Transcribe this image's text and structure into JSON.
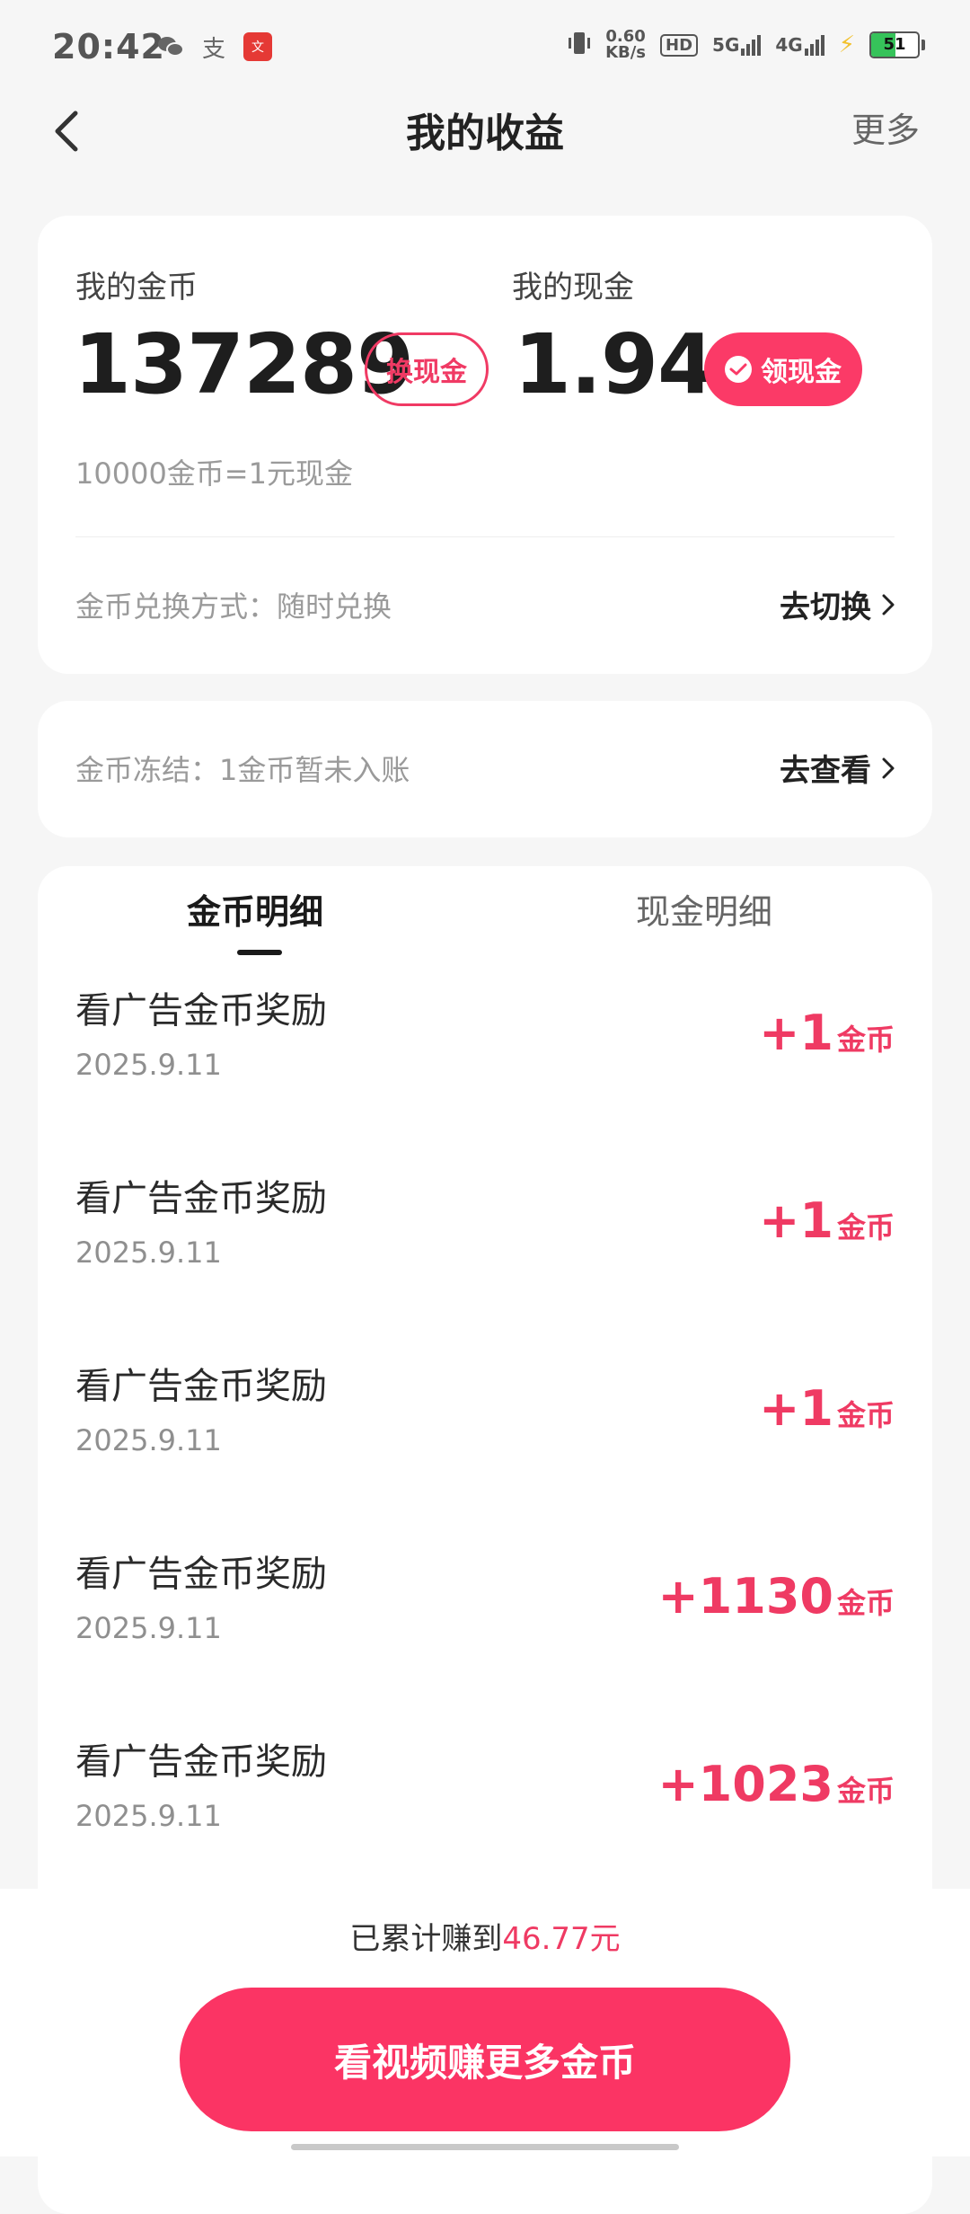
{
  "status_bar": {
    "time": "20:42",
    "speed_value": "0.60",
    "speed_unit": "KB/s",
    "hd": "HD",
    "sig1": "5G",
    "sig2": "4G",
    "battery": "51",
    "battery_level": 51,
    "app_badge": "文",
    "pay_glyph": "支"
  },
  "header": {
    "title": "我的收益",
    "more": "更多"
  },
  "balance": {
    "coins_label": "我的金币",
    "coins_value": "137289",
    "exchange_btn": "换现金",
    "cash_label": "我的现金",
    "cash_value": "1.94",
    "claim_btn": "领现金",
    "rate": "10000金币=1元现金",
    "method_text": "金币兑换方式：随时兑换",
    "method_link": "去切换"
  },
  "freeze": {
    "text": "金币冻结：1金币暂未入账",
    "link": "去查看"
  },
  "tabs": {
    "coins": "金币明细",
    "cash": "现金明细"
  },
  "records": [
    {
      "title": "看广告金币奖励",
      "date": "2025.9.11",
      "amount": "+1",
      "unit": "金币"
    },
    {
      "title": "看广告金币奖励",
      "date": "2025.9.11",
      "amount": "+1",
      "unit": "金币"
    },
    {
      "title": "看广告金币奖励",
      "date": "2025.9.11",
      "amount": "+1",
      "unit": "金币"
    },
    {
      "title": "看广告金币奖励",
      "date": "2025.9.11",
      "amount": "+1130",
      "unit": "金币"
    },
    {
      "title": "看广告金币奖励",
      "date": "2025.9.11",
      "amount": "+1023",
      "unit": "金币"
    }
  ],
  "footer": {
    "earned_prefix": "已累计赚到",
    "earned_amount": "46.77元",
    "cta": "看视频赚更多金币"
  },
  "colors": {
    "accent": "#fb3a67",
    "accent_text": "#ef3a63"
  }
}
